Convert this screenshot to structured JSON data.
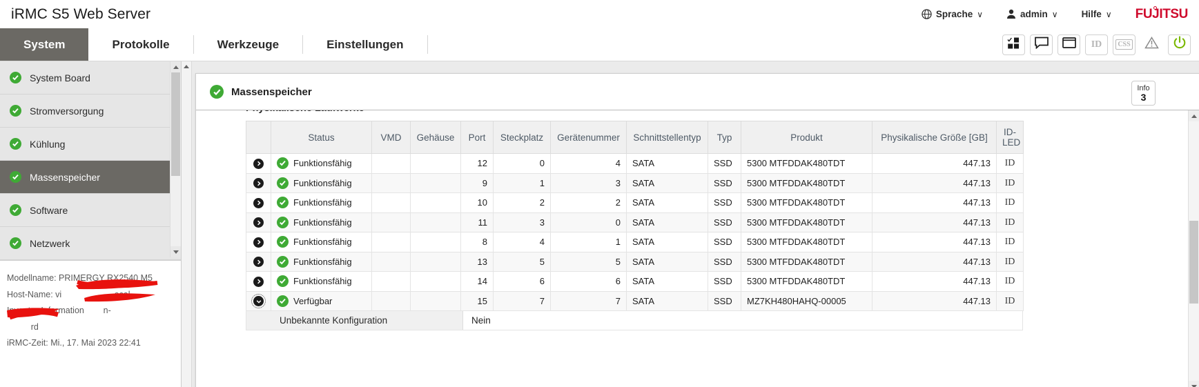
{
  "header": {
    "app_title": "iRMC S5 Web Server",
    "menus": [
      {
        "icon": "globe-icon",
        "label": "Sprache",
        "caret": "∨"
      },
      {
        "icon": "user-icon",
        "label": "admin",
        "caret": "∨"
      },
      {
        "icon": "none",
        "label": "Hilfe",
        "caret": "∨"
      }
    ],
    "brand": "FUJITSU"
  },
  "nav": {
    "tabs": [
      {
        "label": "System",
        "active": true
      },
      {
        "label": "Protokolle",
        "active": false
      },
      {
        "label": "Werkzeuge",
        "active": false
      },
      {
        "label": "Einstellungen",
        "active": false
      }
    ],
    "tools": [
      {
        "name": "dashboard-icon",
        "kind": "svg"
      },
      {
        "name": "chat-icon",
        "kind": "svg"
      },
      {
        "name": "window-icon",
        "kind": "svg"
      },
      {
        "name": "identify-led-icon",
        "kind": "text",
        "text": "ID"
      },
      {
        "name": "css-icon",
        "kind": "text",
        "text": "CSS"
      },
      {
        "name": "warning-icon",
        "kind": "svg"
      },
      {
        "name": "power-icon",
        "kind": "svg"
      }
    ]
  },
  "sidebar": {
    "items": [
      {
        "label": "System Board",
        "status": "ok",
        "active": false
      },
      {
        "label": "Stromversorgung",
        "status": "ok",
        "active": false
      },
      {
        "label": "Kühlung",
        "status": "ok",
        "active": false
      },
      {
        "label": "Massenspeicher",
        "status": "ok",
        "active": true
      },
      {
        "label": "Software",
        "status": "ok",
        "active": false
      },
      {
        "label": "Netzwerk",
        "status": "ok",
        "active": false
      }
    ],
    "system_info": [
      "Modellname: PRIMERGY RX2540 M5",
      "Host-Name: vi██████████████ocal",
      "Inventar-Information██████n-",
      "██████rd",
      "iRMC-Zeit: Mi., 17. Mai 2023 22:41"
    ]
  },
  "panel": {
    "title": "Massenspeicher",
    "status": "ok",
    "info_badge": {
      "label": "Info",
      "count": "3"
    },
    "section_title": "Physikalische Laufwerke"
  },
  "table": {
    "columns": [
      "",
      "Status",
      "VMD",
      "Gehäuse",
      "Port",
      "Steckplatz",
      "Gerätenummer",
      "Schnittstellentyp",
      "Typ",
      "Produkt",
      "Physikalische Größe [GB]",
      "ID-LED"
    ],
    "rows": [
      {
        "expand": "collapsed",
        "status": "Funktionsfähig",
        "vmd": "",
        "gehaeuse": "",
        "port": "12",
        "steckplatz": "0",
        "geraetenummer": "4",
        "schnittstellentyp": "SATA",
        "typ": "SSD",
        "produkt": "5300 MTFDDAK480TDT",
        "groesse": "447.13",
        "idled": "ID"
      },
      {
        "expand": "collapsed",
        "status": "Funktionsfähig",
        "vmd": "",
        "gehaeuse": "",
        "port": "9",
        "steckplatz": "1",
        "geraetenummer": "3",
        "schnittstellentyp": "SATA",
        "typ": "SSD",
        "produkt": "5300 MTFDDAK480TDT",
        "groesse": "447.13",
        "idled": "ID"
      },
      {
        "expand": "collapsed",
        "status": "Funktionsfähig",
        "vmd": "",
        "gehaeuse": "",
        "port": "10",
        "steckplatz": "2",
        "geraetenummer": "2",
        "schnittstellentyp": "SATA",
        "typ": "SSD",
        "produkt": "5300 MTFDDAK480TDT",
        "groesse": "447.13",
        "idled": "ID"
      },
      {
        "expand": "collapsed",
        "status": "Funktionsfähig",
        "vmd": "",
        "gehaeuse": "",
        "port": "11",
        "steckplatz": "3",
        "geraetenummer": "0",
        "schnittstellentyp": "SATA",
        "typ": "SSD",
        "produkt": "5300 MTFDDAK480TDT",
        "groesse": "447.13",
        "idled": "ID"
      },
      {
        "expand": "collapsed",
        "status": "Funktionsfähig",
        "vmd": "",
        "gehaeuse": "",
        "port": "8",
        "steckplatz": "4",
        "geraetenummer": "1",
        "schnittstellentyp": "SATA",
        "typ": "SSD",
        "produkt": "5300 MTFDDAK480TDT",
        "groesse": "447.13",
        "idled": "ID"
      },
      {
        "expand": "collapsed",
        "status": "Funktionsfähig",
        "vmd": "",
        "gehaeuse": "",
        "port": "13",
        "steckplatz": "5",
        "geraetenummer": "5",
        "schnittstellentyp": "SATA",
        "typ": "SSD",
        "produkt": "5300 MTFDDAK480TDT",
        "groesse": "447.13",
        "idled": "ID"
      },
      {
        "expand": "collapsed",
        "status": "Funktionsfähig",
        "vmd": "",
        "gehaeuse": "",
        "port": "14",
        "steckplatz": "6",
        "geraetenummer": "6",
        "schnittstellentyp": "SATA",
        "typ": "SSD",
        "produkt": "5300 MTFDDAK480TDT",
        "groesse": "447.13",
        "idled": "ID"
      },
      {
        "expand": "expanded",
        "status": "Verfügbar",
        "vmd": "",
        "gehaeuse": "",
        "port": "15",
        "steckplatz": "7",
        "geraetenummer": "7",
        "schnittstellentyp": "SATA",
        "typ": "SSD",
        "produkt": "MZ7KH480HAHQ-00005",
        "groesse": "447.13",
        "idled": "ID"
      }
    ],
    "detail_row": {
      "key": "Unbekannte Konfiguration",
      "value": "Nein"
    }
  },
  "colors": {
    "status_green": "#3faa35",
    "brand_red": "#cf0a2c",
    "active_gray": "#6b6964",
    "power_green": "#7ab800"
  }
}
